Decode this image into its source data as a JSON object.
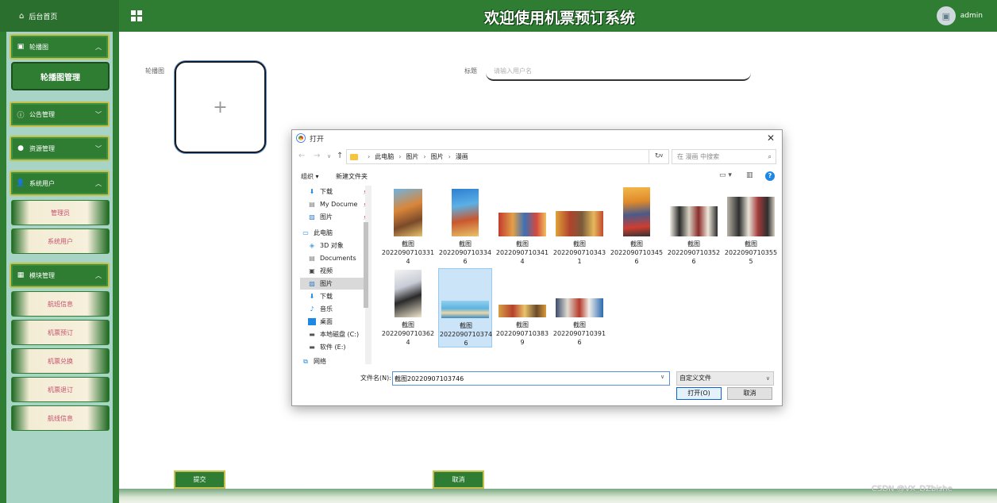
{
  "header": {
    "home_label": "后台首页",
    "title": "欢迎使用机票预订系统",
    "username": "admin"
  },
  "sidebar": {
    "groups": [
      {
        "label": "轮播图",
        "icon": "image-icon"
      },
      {
        "label": "公告管理",
        "icon": "info-icon"
      },
      {
        "label": "资源管理",
        "icon": "bulb-icon"
      },
      {
        "label": "系统用户",
        "icon": "user-icon"
      },
      {
        "label": "模块管理",
        "icon": "grid-icon"
      }
    ],
    "active_item": "轮播图管理",
    "sub_items": [
      "管理员",
      "系统用户",
      "航班信息",
      "机票预订",
      "机票兑换",
      "机票退订",
      "航线信息"
    ]
  },
  "form": {
    "banner_label": "轮播图",
    "upload_plus": "+",
    "title_label": "标题",
    "title_placeholder": "请输入用户名",
    "submit_label": "提交",
    "cancel_label": "取消"
  },
  "dialog": {
    "title": "打开",
    "breadcrumb": [
      "此电脑",
      "图片",
      "图片",
      "漫画"
    ],
    "search_placeholder": "在 漫画 中搜索",
    "organize_label": "组织 ▾",
    "new_folder_label": "新建文件夹",
    "nav_items": [
      {
        "label": "下载",
        "icon": "download-icon",
        "pinned": true
      },
      {
        "label": "My Docume",
        "icon": "document-icon",
        "pinned": true
      },
      {
        "label": "图片",
        "icon": "pictures-icon",
        "pinned": true
      },
      {
        "label": "此电脑",
        "icon": "computer-icon",
        "pinned": false
      },
      {
        "label": "3D 对象",
        "icon": "cube-icon",
        "pinned": false
      },
      {
        "label": "Documents",
        "icon": "document-icon",
        "pinned": false
      },
      {
        "label": "视频",
        "icon": "video-icon",
        "pinned": false
      },
      {
        "label": "图片",
        "icon": "pictures-icon",
        "pinned": false,
        "selected": true
      },
      {
        "label": "下载",
        "icon": "download-icon",
        "pinned": false
      },
      {
        "label": "音乐",
        "icon": "music-icon",
        "pinned": false
      },
      {
        "label": "桌面",
        "icon": "desktop-icon",
        "pinned": false
      },
      {
        "label": "本地磁盘 (C:)",
        "icon": "drive-icon",
        "pinned": false
      },
      {
        "label": "软件 (E:)",
        "icon": "drive-icon",
        "pinned": false
      },
      {
        "label": "网络",
        "icon": "network-icon",
        "pinned": false
      }
    ],
    "files": [
      {
        "line1": "截图",
        "line2": "2022090710331",
        "line3": "4"
      },
      {
        "line1": "截图",
        "line2": "2022090710334",
        "line3": "6"
      },
      {
        "line1": "截图",
        "line2": "2022090710341",
        "line3": "4"
      },
      {
        "line1": "截图",
        "line2": "2022090710343",
        "line3": "1"
      },
      {
        "line1": "截图",
        "line2": "2022090710345",
        "line3": "6"
      },
      {
        "line1": "截图",
        "line2": "2022090710352",
        "line3": "6"
      },
      {
        "line1": "截图",
        "line2": "2022090710355",
        "line3": "5"
      },
      {
        "line1": "截图",
        "line2": "2022090710362",
        "line3": "4"
      },
      {
        "line1": "截图",
        "line2": "2022090710374",
        "line3": "6",
        "selected": true
      },
      {
        "line1": "截图",
        "line2": "2022090710383",
        "line3": "9"
      },
      {
        "line1": "截图",
        "line2": "2022090710391",
        "line3": "6"
      }
    ],
    "filename_label": "文件名(N):",
    "filename_value": "截图20220907103746",
    "filter_value": "自定义文件",
    "open_label": "打开(O)",
    "cancel_label": "取消"
  },
  "watermark": "CSDN @VX_DZbishe",
  "colors": {
    "primary_green": "#2e7d32",
    "gold_border": "#c4c04a",
    "sidebar_bg": "#a8d4c6",
    "sub_item_text": "#c9506e"
  }
}
